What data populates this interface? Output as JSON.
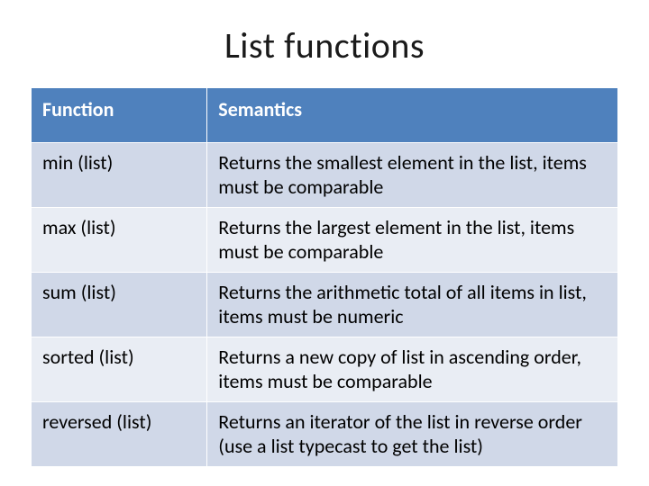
{
  "title": "List functions",
  "table": {
    "headers": {
      "col1": "Function",
      "col2": "Semantics"
    },
    "rows": [
      {
        "fn": "min (list)",
        "desc": "Returns the smallest element in the list, items must be comparable"
      },
      {
        "fn": "max (list)",
        "desc": "Returns the largest element in the list, items must be comparable"
      },
      {
        "fn": "sum (list)",
        "desc": "Returns the arithmetic total of all items in list, items must be numeric"
      },
      {
        "fn": "sorted (list)",
        "desc": "Returns a new copy of list in ascending order, items must be comparable"
      },
      {
        "fn": "reversed (list)",
        "desc": "Returns an iterator of the list in reverse order (use a list typecast to get the list)"
      }
    ]
  }
}
